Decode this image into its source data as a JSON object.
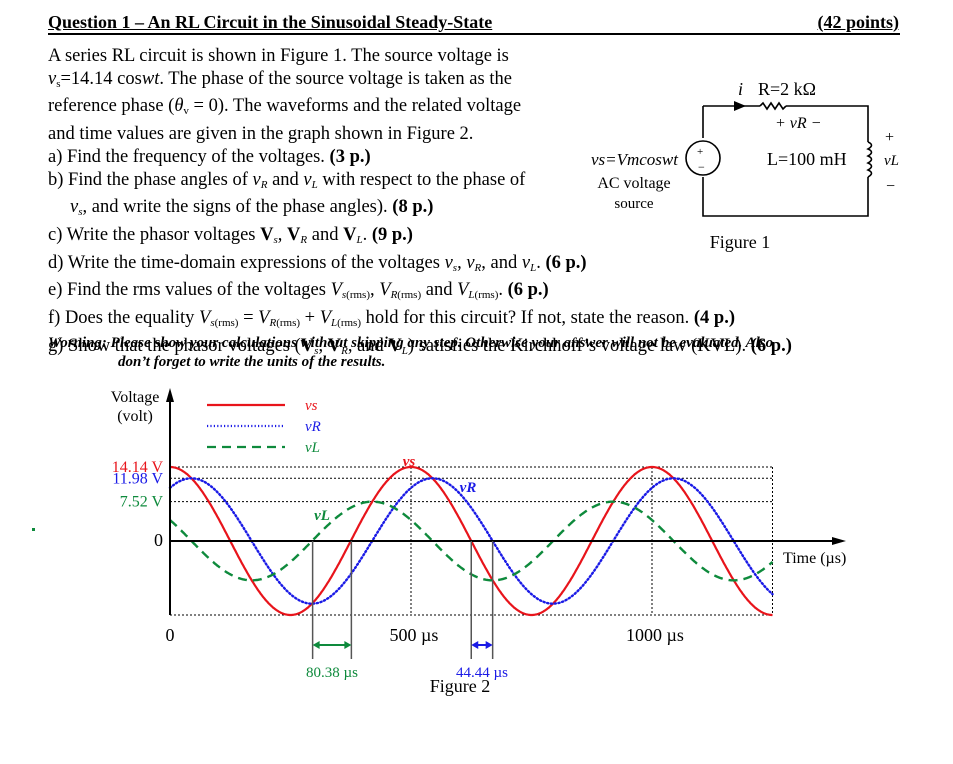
{
  "header": {
    "title": "Question 1 – An RL Circuit in the Sinusoidal Steady-State",
    "points": "(42 points)"
  },
  "intro": {
    "line1": "A series RL circuit is shown in Figure 1. The source voltage is",
    "line2_var": "v",
    "line2_sub": "s",
    "line2_rest": "=14.14 cos",
    "line2_wt": "wt",
    "line2_tail": ". The phase of the source voltage is taken as the",
    "line3_a": "reference phase (",
    "line3_theta": "θ",
    "line3_sub": "v",
    "line3_b": " = 0). The waveforms and the related voltage",
    "line4": "and time values are given in the graph shown in Figure 2."
  },
  "questions": [
    {
      "id": "a",
      "text": "a) Find the frequency of the voltages. ",
      "points": "(3 p.)"
    },
    {
      "id": "b",
      "text": "b) Find the phase angles of vR and vL with respect to the phase of vs, and write the signs of the phase angles). ",
      "points": "(8 p.)"
    },
    {
      "id": "c",
      "text": "c) Write the phasor voltages Vs, VR and VL. ",
      "points": "(9 p.)"
    },
    {
      "id": "d",
      "text": "d) Write the time-domain expressions of the voltages vs, vR, and vL. ",
      "points": "(6 p.)"
    },
    {
      "id": "e",
      "text": "e) Find the rms values of the voltages Vs(rms), VR(rms) and VL(rms). ",
      "points": "(6 p.)"
    },
    {
      "id": "f",
      "text": "f) Does the equality Vs(rms) = VR(rms) + VL(rms) hold for this circuit? If not, state the reason. ",
      "points": "(4 p.)"
    },
    {
      "id": "g",
      "text": "g) Show that the phasor voltages (Vs, VR, and VL) satisfies the Kirchhoff’s voltage law (KVL). ",
      "points": "(6 p.)"
    }
  ],
  "warning": {
    "line1": "Worning: Please show your calculations without skipping any step. Otherwise your answer will not be evaluated. Also",
    "line2": "don’t forget to write the units of the results."
  },
  "figure1": {
    "current_label": "i",
    "resistor_label": "R=2 kΩ",
    "vr_label": "+ vR −",
    "inductor_label": "L=100 mH",
    "vl_plus": "+",
    "vl_label": "vL",
    "vl_minus": "−",
    "source_eq": "vs=Vmcoswt",
    "source_line2": "AC voltage",
    "source_line3": "source",
    "caption": "Figure 1"
  },
  "chart_data": {
    "type": "line",
    "title": "Figure 2",
    "xlabel": "Time (µs)",
    "ylabel": "Voltage (volt)",
    "xlim": [
      0,
      1250
    ],
    "ylim": [
      -14.14,
      14.14
    ],
    "period_us": 500,
    "x_ticks": [
      "0",
      "500 µs",
      "1000 µs"
    ],
    "x_tick_values": [
      0,
      500,
      1000
    ],
    "y_ticks": [
      {
        "label": "14.14 V",
        "value": 14.14,
        "color": "#e8141b"
      },
      {
        "label": "11.98 V",
        "value": 11.98,
        "color": "#1a1ae6"
      },
      {
        "label": "7.52 V",
        "value": 7.52,
        "color": "#0e8a3c"
      },
      {
        "label": "0",
        "value": 0,
        "color": "#000000"
      }
    ],
    "series": [
      {
        "name": "vs",
        "amplitude": 14.14,
        "phase_deg": 0,
        "color": "#e8141b",
        "style": "solid"
      },
      {
        "name": "vR",
        "amplitude": 11.98,
        "phase_deg": -32,
        "color": "#1a1ae6",
        "style": "dotted"
      },
      {
        "name": "vL",
        "amplitude": 7.52,
        "phase_deg": 57.87,
        "color": "#0e8a3c",
        "style": "dashed"
      }
    ],
    "legend": [
      "vs",
      "vR",
      "vL"
    ],
    "legend_position": "top-left",
    "annotations": [
      {
        "text": "80.38 µs",
        "color": "#0e8a3c",
        "from_us": 295.9,
        "to_us": 376.3
      },
      {
        "text": "44.44 µs",
        "color": "#1a1ae6",
        "from_us": 625,
        "to_us": 669.4
      },
      {
        "text": "vs",
        "color": "#e8141b"
      },
      {
        "text": "vR",
        "color": "#1a1ae6"
      },
      {
        "text": "vL",
        "color": "#0e8a3c"
      }
    ],
    "grid": true
  }
}
